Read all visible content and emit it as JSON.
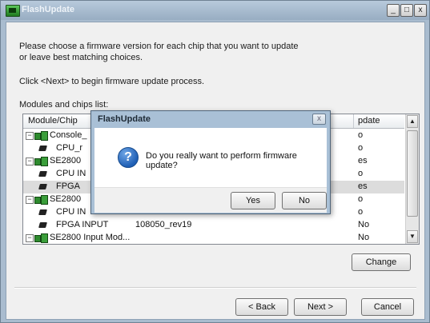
{
  "window": {
    "title": "FlashUpdate",
    "minimize": "_",
    "maximize": "□",
    "close": "x"
  },
  "instructions": {
    "line1": "Please choose a firmware version for each chip that you want to update",
    "line2": "or leave best matching choices.",
    "line3": "Click <Next> to begin firmware update process.",
    "line4": "Modules and chips list:"
  },
  "list": {
    "columns": [
      "Module/Chip",
      "Update"
    ],
    "header_partial": "pdate",
    "rows": [
      {
        "type": "module",
        "expander": "−",
        "name": "Console_",
        "version": "",
        "update": "o"
      },
      {
        "type": "chip",
        "name": "CPU_r",
        "version": "",
        "update": "o"
      },
      {
        "type": "module",
        "expander": "−",
        "name": "SE2800",
        "version": "",
        "update": "es"
      },
      {
        "type": "chip",
        "name": "CPU IN",
        "version": "",
        "update": "o"
      },
      {
        "type": "chip",
        "name": "FPGA",
        "version": "",
        "update": "es",
        "selected": true
      },
      {
        "type": "module",
        "expander": "−",
        "name": "SE2800",
        "version": "",
        "update": "o"
      },
      {
        "type": "chip",
        "name": "CPU IN",
        "version": "",
        "update": "o"
      },
      {
        "type": "chip",
        "name": "FPGA INPUT",
        "version": "108050_rev19",
        "update": "No"
      },
      {
        "type": "module",
        "expander": "−",
        "name": "SE2800 Input Mod...",
        "version": "",
        "update": "No"
      }
    ],
    "scroll_up": "▲",
    "scroll_down": "▼"
  },
  "buttons": {
    "change": "Change",
    "back": "< Back",
    "next": "Next >",
    "cancel": "Cancel"
  },
  "dialog": {
    "title": "FlashUpdate",
    "close": "x",
    "icon": "question-icon",
    "icon_glyph": "?",
    "message": "Do you really want to perform firmware update?",
    "yes": "Yes",
    "no": "No"
  }
}
